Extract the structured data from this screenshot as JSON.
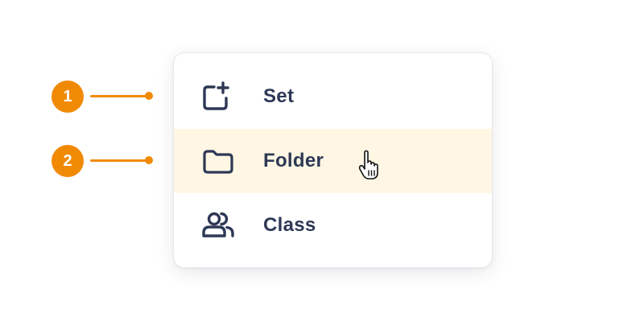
{
  "menu": {
    "items": [
      {
        "label": "Set",
        "icon": "add-set-icon",
        "badge": "1"
      },
      {
        "label": "Folder",
        "icon": "folder-icon",
        "badge": "2",
        "hovered": true
      },
      {
        "label": "Class",
        "icon": "users-icon"
      }
    ]
  },
  "colors": {
    "accent": "#f08a05",
    "hover_background": "#fff7e3",
    "text": "#2e3856"
  },
  "cursor": {
    "icon": "hand-pointer-cursor-icon"
  }
}
